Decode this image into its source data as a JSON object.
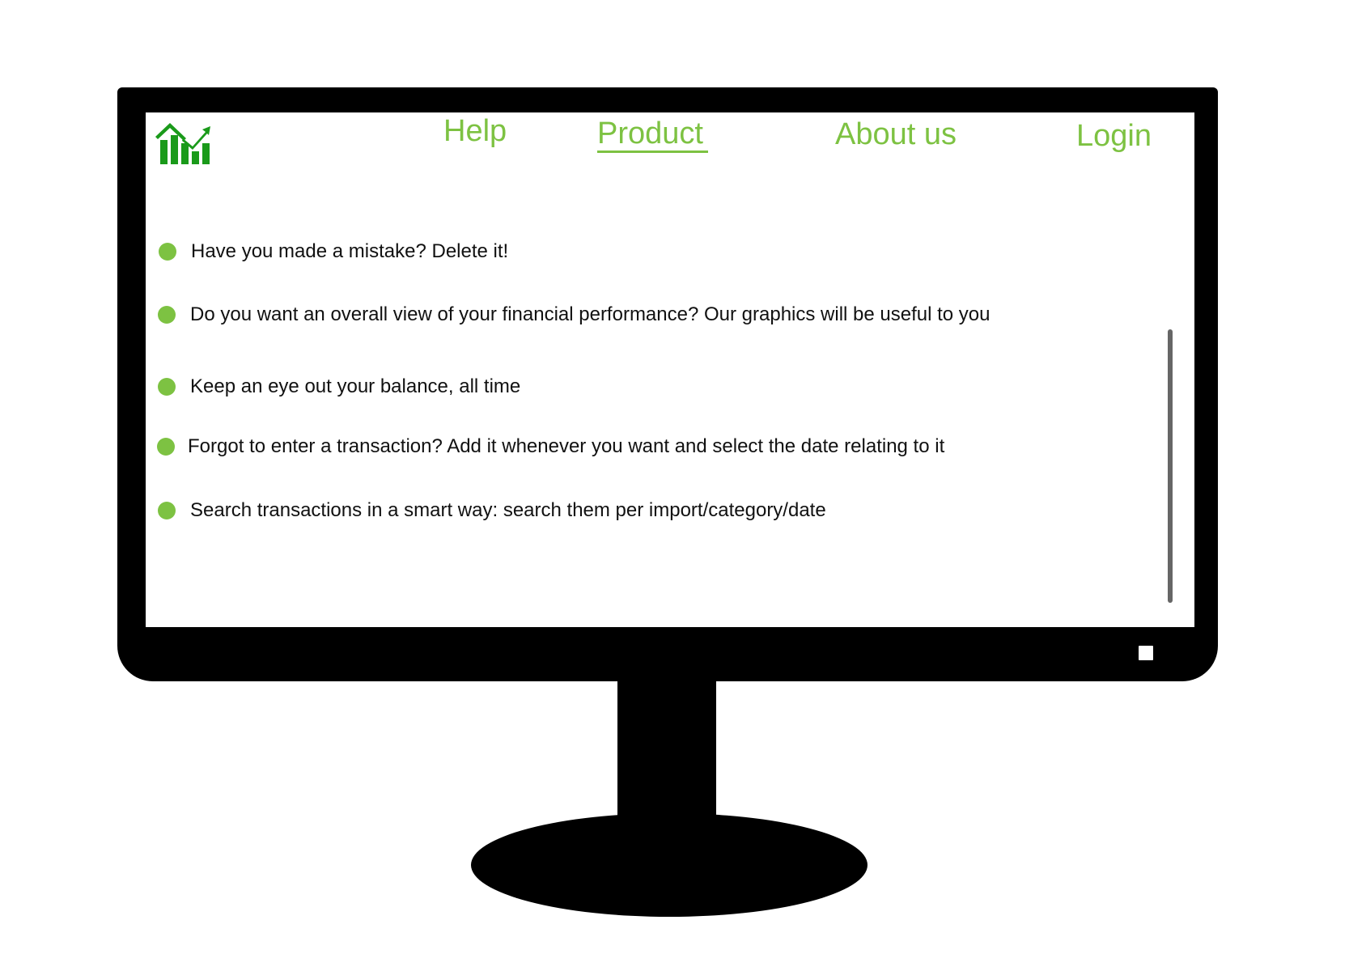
{
  "header": {
    "logo_icon": "bar-chart-trend-icon",
    "nav": [
      {
        "label": "Help",
        "active": false
      },
      {
        "label": "Product",
        "active": true
      },
      {
        "label": "About us",
        "active": false
      },
      {
        "label": "Login",
        "active": false
      }
    ]
  },
  "features": [
    "Have you made a mistake? Delete it!",
    "Do you want an overall view of your financial performance? Our graphics will be useful to you",
    "Keep an eye out your balance, all time",
    "Forgot to enter a transaction? Add it whenever you want and select the date relating to it",
    "Search transactions in a smart way: search them per import/category/date"
  ],
  "colors": {
    "accent": "#7dc242",
    "logo": "#1a9a1a",
    "text": "#111111",
    "bezel": "#000000",
    "scrollbar": "#666666"
  }
}
